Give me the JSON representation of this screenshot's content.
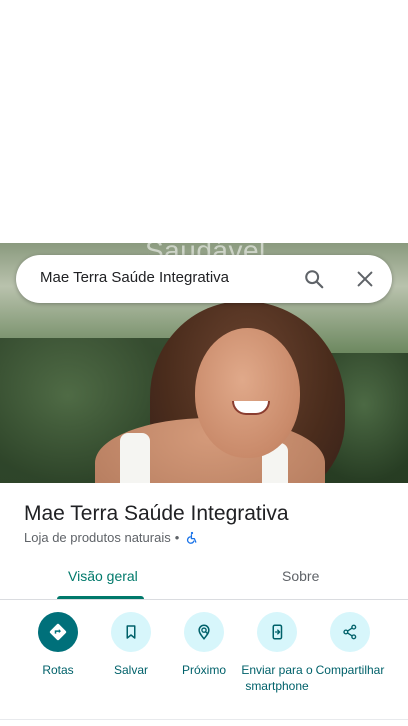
{
  "hero": {
    "background_text": "Saudável"
  },
  "search": {
    "query": "Mae Terra Saúde Integrativa",
    "search_icon": "search-icon",
    "close_icon": "close-icon"
  },
  "place": {
    "title": "Mae Terra Saúde Integrativa",
    "category": "Loja de produtos naturais",
    "separator": "•",
    "accessibility_icon": "wheelchair-accessible-icon",
    "accessibility_color": "#1a73e8"
  },
  "tabs": [
    {
      "label": "Visão geral",
      "active": true
    },
    {
      "label": "Sobre",
      "active": false
    }
  ],
  "actions": [
    {
      "label": "Rotas",
      "icon": "directions-icon",
      "primary": true
    },
    {
      "label": "Salvar",
      "icon": "bookmark-icon",
      "primary": false
    },
    {
      "label": "Próximo",
      "icon": "nearby-icon",
      "primary": false
    },
    {
      "label": "Enviar para o smartphone",
      "icon": "send-to-phone-icon",
      "primary": false
    },
    {
      "label": "Compartilhar",
      "icon": "share-icon",
      "primary": false
    }
  ],
  "colors": {
    "accent": "#00796b",
    "action_primary": "#00707a",
    "action_secondary_bg": "#d7f6fb",
    "action_label": "#00616a"
  }
}
